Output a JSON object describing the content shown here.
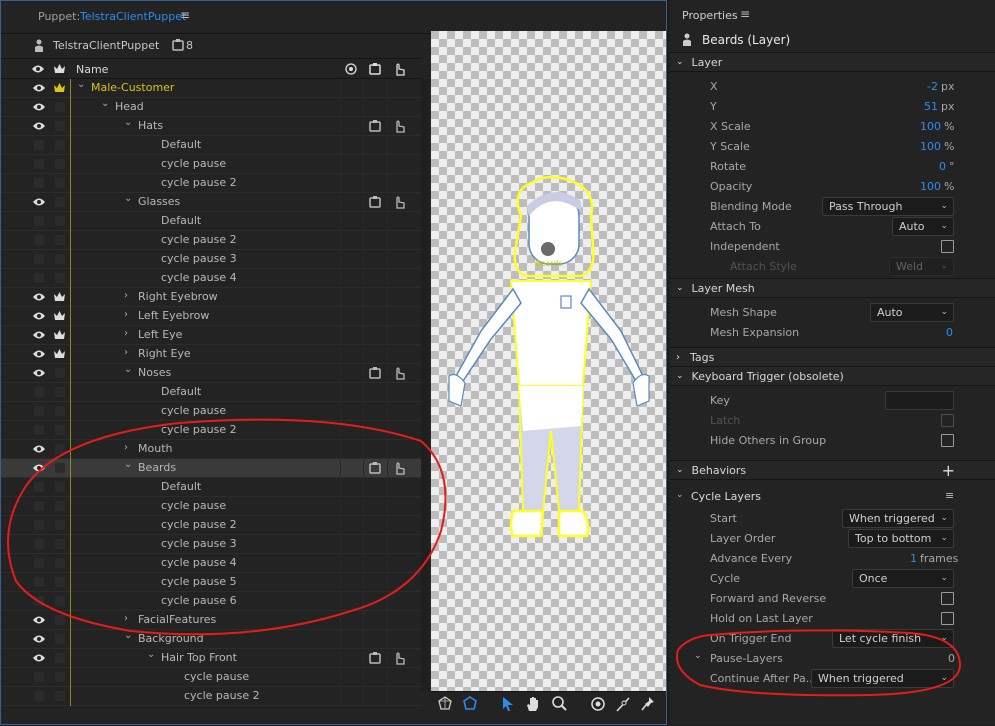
{
  "puppet_panel": {
    "title_prefix": "Puppet:",
    "title_name": "TelstraClientPuppet",
    "puppet_name": "TelstraClientPuppet",
    "count": "8",
    "col_name": "Name"
  },
  "layers": [
    {
      "name": "Male-Customer",
      "indent": 1,
      "exp": "down",
      "eye": true,
      "crown": true,
      "gold": true,
      "icons": false
    },
    {
      "name": "Head",
      "indent": 2,
      "exp": "down",
      "eye": true,
      "crown": false,
      "icons": false
    },
    {
      "name": "Hats",
      "indent": 3,
      "exp": "down",
      "eye": true,
      "crown": false,
      "icons": true
    },
    {
      "name": "Default",
      "indent": 4,
      "exp": "",
      "eye": false,
      "crown": false,
      "icons": false
    },
    {
      "name": "cycle pause",
      "indent": 4,
      "exp": "",
      "eye": false,
      "crown": false,
      "icons": false
    },
    {
      "name": "cycle pause 2",
      "indent": 4,
      "exp": "",
      "eye": false,
      "crown": false,
      "icons": false
    },
    {
      "name": "Glasses",
      "indent": 3,
      "exp": "down",
      "eye": true,
      "crown": false,
      "icons": true
    },
    {
      "name": "Default",
      "indent": 4,
      "exp": "",
      "eye": false,
      "crown": false,
      "icons": false
    },
    {
      "name": "cycle pause 2",
      "indent": 4,
      "exp": "",
      "eye": false,
      "crown": false,
      "icons": false
    },
    {
      "name": "cycle pause 3",
      "indent": 4,
      "exp": "",
      "eye": false,
      "crown": false,
      "icons": false
    },
    {
      "name": "cycle pause 4",
      "indent": 4,
      "exp": "",
      "eye": false,
      "crown": false,
      "icons": false
    },
    {
      "name": "Right Eyebrow",
      "indent": 3,
      "exp": "right",
      "eye": true,
      "crown": true,
      "icons": false
    },
    {
      "name": "Left Eyebrow",
      "indent": 3,
      "exp": "right",
      "eye": true,
      "crown": true,
      "icons": false
    },
    {
      "name": "Left Eye",
      "indent": 3,
      "exp": "right",
      "eye": true,
      "crown": true,
      "icons": false
    },
    {
      "name": "Right Eye",
      "indent": 3,
      "exp": "right",
      "eye": true,
      "crown": true,
      "icons": false
    },
    {
      "name": "Noses",
      "indent": 3,
      "exp": "down",
      "eye": true,
      "crown": false,
      "icons": true
    },
    {
      "name": "Default",
      "indent": 4,
      "exp": "",
      "eye": false,
      "crown": false,
      "icons": false
    },
    {
      "name": "cycle pause",
      "indent": 4,
      "exp": "",
      "eye": false,
      "crown": false,
      "icons": false
    },
    {
      "name": "cycle pause 2",
      "indent": 4,
      "exp": "",
      "eye": false,
      "crown": false,
      "icons": false
    },
    {
      "name": "Mouth",
      "indent": 3,
      "exp": "right",
      "eye": true,
      "crown": false,
      "icons": false
    },
    {
      "name": "Beards",
      "indent": 3,
      "exp": "down",
      "eye": true,
      "crown": false,
      "icons": true,
      "selected": true
    },
    {
      "name": "Default",
      "indent": 4,
      "exp": "",
      "eye": false,
      "crown": false,
      "icons": false
    },
    {
      "name": "cycle pause",
      "indent": 4,
      "exp": "",
      "eye": false,
      "crown": false,
      "icons": false
    },
    {
      "name": "cycle pause 2",
      "indent": 4,
      "exp": "",
      "eye": false,
      "crown": false,
      "icons": false
    },
    {
      "name": "cycle pause 3",
      "indent": 4,
      "exp": "",
      "eye": false,
      "crown": false,
      "icons": false
    },
    {
      "name": "cycle pause 4",
      "indent": 4,
      "exp": "",
      "eye": false,
      "crown": false,
      "icons": false
    },
    {
      "name": "cycle pause 5",
      "indent": 4,
      "exp": "",
      "eye": false,
      "crown": false,
      "icons": false
    },
    {
      "name": "cycle pause 6",
      "indent": 4,
      "exp": "",
      "eye": false,
      "crown": false,
      "icons": false
    },
    {
      "name": "FacialFeatures",
      "indent": 3,
      "exp": "right",
      "eye": true,
      "crown": false,
      "icons": false
    },
    {
      "name": "Background",
      "indent": 3,
      "exp": "down",
      "eye": true,
      "crown": false,
      "icons": false
    },
    {
      "name": "Hair Top Front",
      "indent": 4,
      "exp": "down",
      "eye": true,
      "crown": false,
      "icons": true
    },
    {
      "name": "cycle pause",
      "indent": 5,
      "exp": "",
      "eye": false,
      "crown": false,
      "icons": false
    },
    {
      "name": "cycle pause 2",
      "indent": 5,
      "exp": "",
      "eye": false,
      "crown": false,
      "icons": false
    }
  ],
  "canvas": {
    "tag": "Beards"
  },
  "properties": {
    "title": "Properties",
    "layer_name": "Beards (Layer)",
    "sections": {
      "layer": "Layer",
      "layer_mesh": "Layer Mesh",
      "tags": "Tags",
      "keyboard_trigger": "Keyboard Trigger (obsolete)",
      "behaviors": "Behaviors",
      "cycle_layers": "Cycle Layers"
    },
    "layer": {
      "x": {
        "label": "X",
        "value": "-2",
        "unit": "px"
      },
      "y": {
        "label": "Y",
        "value": "51",
        "unit": "px"
      },
      "x_scale": {
        "label": "X Scale",
        "value": "100",
        "unit": "%"
      },
      "y_scale": {
        "label": "Y Scale",
        "value": "100",
        "unit": "%"
      },
      "rotate": {
        "label": "Rotate",
        "value": "0",
        "unit": "°"
      },
      "opacity": {
        "label": "Opacity",
        "value": "100",
        "unit": "%"
      },
      "blending_mode": {
        "label": "Blending Mode",
        "value": "Pass Through"
      },
      "attach_to": {
        "label": "Attach To",
        "value": "Auto"
      },
      "independent": {
        "label": "Independent"
      },
      "attach_style": {
        "label": "Attach Style",
        "value": "Weld"
      }
    },
    "mesh": {
      "mesh_shape": {
        "label": "Mesh Shape",
        "value": "Auto"
      },
      "mesh_expansion": {
        "label": "Mesh Expansion",
        "value": "0"
      }
    },
    "keyboard": {
      "key": {
        "label": "Key"
      },
      "latch": {
        "label": "Latch"
      },
      "hide_others": {
        "label": "Hide Others in Group"
      }
    },
    "cycle": {
      "start": {
        "label": "Start",
        "value": "When triggered"
      },
      "layer_order": {
        "label": "Layer Order",
        "value": "Top to bottom"
      },
      "advance_every": {
        "label": "Advance Every",
        "value": "1",
        "unit": "frames"
      },
      "cycle": {
        "label": "Cycle",
        "value": "Once"
      },
      "forward_reverse": {
        "label": "Forward and Reverse"
      },
      "hold_last": {
        "label": "Hold on Last Layer"
      },
      "on_trigger_end": {
        "label": "On Trigger End",
        "value": "Let cycle finish"
      },
      "pause_layers": {
        "label": "Pause-Layers",
        "value": "0"
      },
      "continue_after": {
        "label": "Continue After Pa...",
        "value": "When triggered"
      }
    }
  }
}
